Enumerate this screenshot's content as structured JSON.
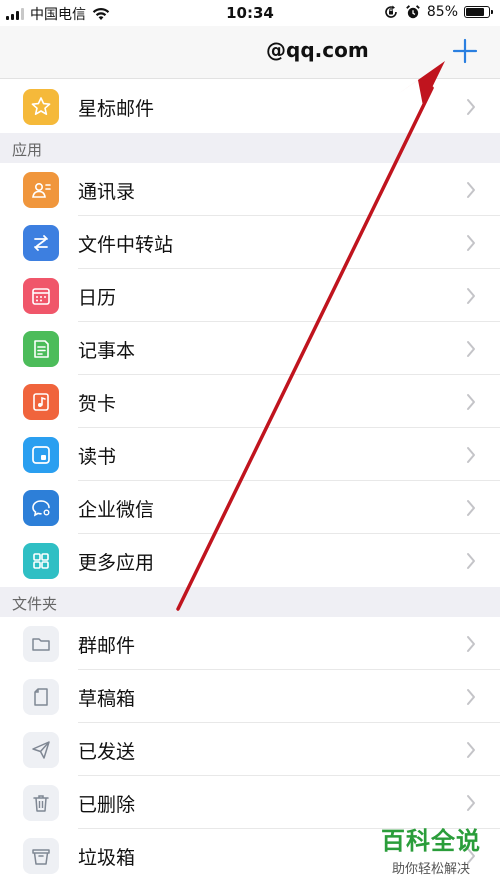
{
  "status_bar": {
    "carrier": "中国电信",
    "time": "10:34",
    "battery": "85%",
    "battery_level": 0.85
  },
  "nav": {
    "title": "@qq.com",
    "add_icon": "plus-icon"
  },
  "top_items": [
    {
      "label": "星标邮件",
      "icon": "star-icon",
      "color": "#f5b93a"
    }
  ],
  "sections": [
    {
      "header": "应用",
      "items": [
        {
          "label": "通讯录",
          "icon": "contacts-icon",
          "color": "#f0963c"
        },
        {
          "label": "文件中转站",
          "icon": "file-transfer-icon",
          "color": "#3d7fe0"
        },
        {
          "label": "日历",
          "icon": "calendar-icon",
          "color": "#f0566a"
        },
        {
          "label": "记事本",
          "icon": "notepad-icon",
          "color": "#4cbc5a"
        },
        {
          "label": "贺卡",
          "icon": "greeting-card-icon",
          "color": "#f0643c"
        },
        {
          "label": "读书",
          "icon": "reading-icon",
          "color": "#2a9ff0"
        },
        {
          "label": "企业微信",
          "icon": "wecom-icon",
          "color": "#2d7fd8"
        },
        {
          "label": "更多应用",
          "icon": "more-apps-icon",
          "color": "#2fbfc4"
        }
      ]
    },
    {
      "header": "文件夹",
      "items": [
        {
          "label": "群邮件",
          "icon": "folder-icon",
          "color": "#eef0f4"
        },
        {
          "label": "草稿箱",
          "icon": "draft-icon",
          "color": "#eef0f4"
        },
        {
          "label": "已发送",
          "icon": "sent-icon",
          "color": "#eef0f4"
        },
        {
          "label": "已删除",
          "icon": "trash-icon",
          "color": "#eef0f4"
        },
        {
          "label": "垃圾箱",
          "icon": "junk-icon",
          "color": "#eef0f4"
        }
      ]
    }
  ],
  "accent_color": "#2a7fe0",
  "annotation_color": "#c0141e",
  "watermark": {
    "title": "百科全说",
    "subtitle": "助你轻松解决"
  }
}
